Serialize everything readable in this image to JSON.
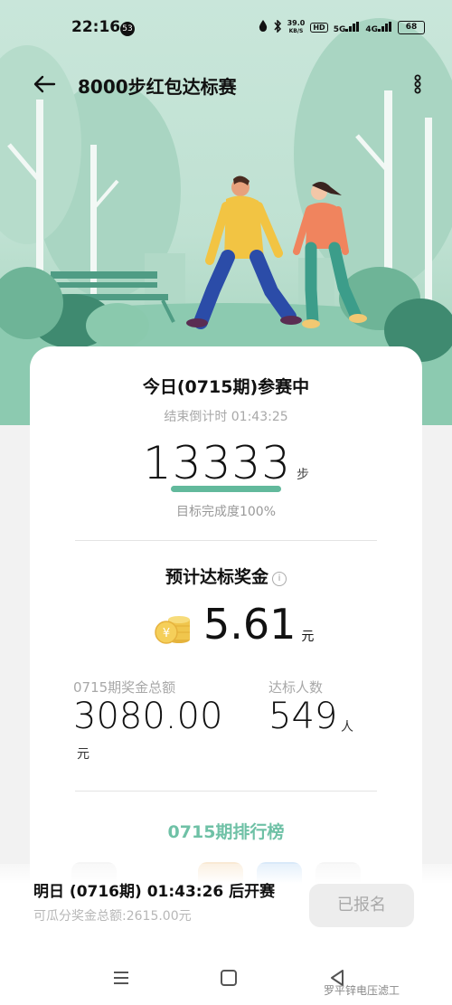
{
  "status_bar": {
    "time": "22:16",
    "notification_count": "53",
    "net_speed_value": "39.0",
    "net_speed_unit": "KB/S",
    "hd_label": "HD",
    "sig1_label": "5G",
    "sig2_label": "4G",
    "battery": "68"
  },
  "app_bar": {
    "title": "8000步红包达标赛"
  },
  "today": {
    "title": "今日(0715期)参赛中",
    "countdown": "结束倒计时 01:43:25",
    "steps": "13333",
    "steps_unit": "步",
    "completion_label": "目标完成度100%",
    "completion_fraction": 1.0
  },
  "prize": {
    "title": "预计达标奖金",
    "info_glyph": "i",
    "amount": "5.61",
    "unit": "元"
  },
  "stats": {
    "pool_label": "0715期奖金总额",
    "pool_value": "3080.00",
    "pool_unit": "元",
    "qualified_label": "达标人数",
    "qualified_value": "549",
    "qualified_unit": "人"
  },
  "ranking": {
    "title": "0715期排行榜"
  },
  "bottom": {
    "open_text": "明日 (0716期) 01:43:26 后开赛",
    "pool_text": "可瓜分奖金总额:2615.00元",
    "signed_label": "已报名"
  },
  "watermark": "罗平锌电压滤工",
  "colors": {
    "accent_green": "#62b99c",
    "ranking_green": "#6fc1a6",
    "hero_bg": "#c9e6da"
  }
}
